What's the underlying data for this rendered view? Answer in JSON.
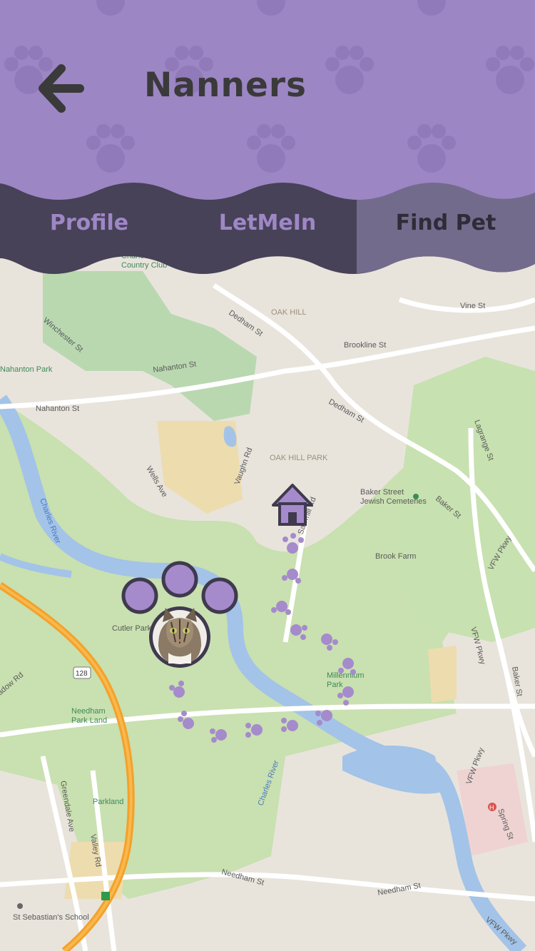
{
  "header": {
    "title": "Nanners",
    "back_icon": "arrow-left-icon"
  },
  "tabs": [
    {
      "label": "Profile",
      "active": false
    },
    {
      "label": "LetMeIn",
      "active": false
    },
    {
      "label": "Find Pet",
      "active": true
    }
  ],
  "map": {
    "labels": {
      "country_club": "Charles\nCountry Club",
      "oak_hill": "OAK HILL",
      "vine_st": "Vine St",
      "brookline_st": "Brookline St",
      "dedham_st_1": "Dedham St",
      "dedham_st_2": "Dedham St",
      "winchester_st": "Winchester St",
      "nahanton_park": "Nahanton Park",
      "nahanton_st_1": "Nahanton St",
      "nahanton_st_2": "Nahanton St",
      "oak_hill_park": "OAK HILL PARK",
      "wells_ave": "Wells Ave",
      "vaughn_rd": "Vaughn Rd",
      "baker_street_cem": "Baker Street\nJewish Cemeteries",
      "baker_st_1": "Baker St",
      "baker_st_2": "Baker St",
      "brook_farm": "Brook Farm",
      "charles_river_1": "Charles River",
      "charles_river_2": "Charles River",
      "cutler_park": "Cutler Park",
      "needham_park_land": "Needham\nPark Land",
      "millennium_park": "Millennium\nPark",
      "vfw_pkwy_1": "VFW Pkwy",
      "vfw_pkwy_2": "VFW Pkwy",
      "vfw_pkwy_3": "VFW Pkwy",
      "vfw_pkwy_4": "VFW Pkwy",
      "parkland": "Parkland",
      "needham_st_1": "Needham St",
      "needham_st_2": "Needham St",
      "spring_st": "Spring St",
      "lagrange_st": "Lagrange St",
      "greendale_ave": "Greendale Ave",
      "valley_rd": "Valley Rd",
      "meadow_rd": "adow Rd",
      "st_sebastians": "St Sebastian's School",
      "route_128": "128",
      "sawmill_rd": "Sawmill Rd",
      "hospital": "H"
    }
  },
  "colors": {
    "header_purple": "#9c86c4",
    "tab_dark": "#474257",
    "tab_active": "#736b8c",
    "paw_purple": "#a58bcb",
    "pet_ring": "#3f3a4e"
  },
  "pet": {
    "name_icon": "cat-avatar"
  }
}
